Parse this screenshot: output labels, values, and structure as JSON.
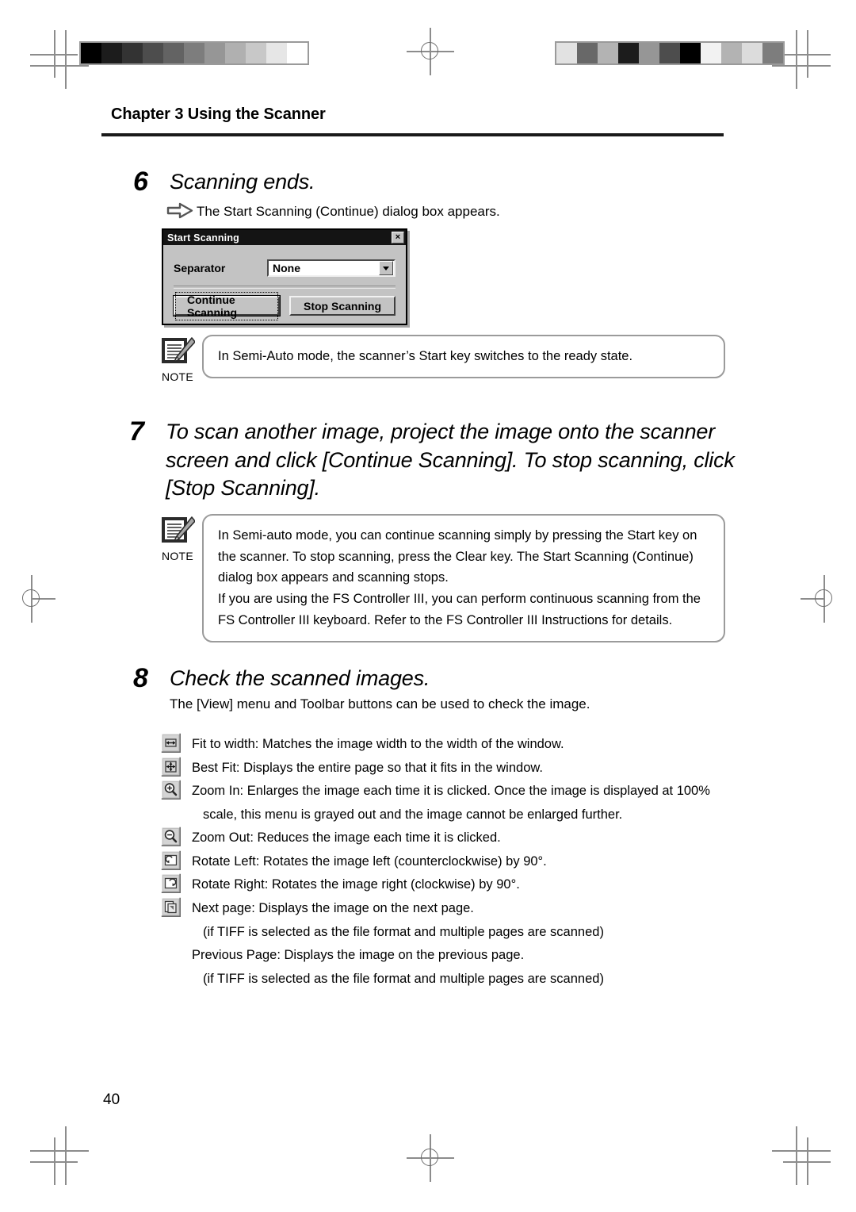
{
  "page": {
    "chapter_header": "Chapter 3 Using the Scanner",
    "page_number": "40"
  },
  "steps": [
    {
      "number": "6",
      "title": "Scanning ends.",
      "callout_arrow_text": "The Start Scanning (Continue) dialog box appears."
    },
    {
      "number": "7",
      "title": "To scan another image, project the image onto the scanner screen and click [Continue Scanning]. To stop scanning, click [Stop Scanning]."
    },
    {
      "number": "8",
      "title": "Check the scanned images.",
      "intro": "The [View] menu and Toolbar buttons can be used to check the image."
    }
  ],
  "dialog": {
    "title": "Start Scanning",
    "close_label": "×",
    "separator_label": "Separator",
    "separator_value": "None",
    "separator_options": [
      "None"
    ],
    "continue_button": "Continue Scanning",
    "stop_button": "Stop Scanning"
  },
  "notes": [
    {
      "label": "NOTE",
      "lines": [
        "In Semi-Auto mode, the scanner’s Start key switches to the ready state."
      ]
    },
    {
      "label": "NOTE",
      "lines": [
        "In Semi-auto mode, you can continue scanning simply by pressing the Start key on the scanner. To stop scanning, press the Clear key. The Start Scanning (Continue) dialog box appears and scanning stops.",
        "If you are using the FS Controller III, you can perform continuous scanning from the FS Controller III keyboard. Refer to the FS Controller III Instructions for details."
      ]
    }
  ],
  "toolbar_items": [
    {
      "icon": "fit-to-width-icon",
      "text": "Fit to width: Matches the image width to the width of the window."
    },
    {
      "icon": "best-fit-icon",
      "text": "Best Fit: Displays the entire page so that it fits in the window."
    },
    {
      "icon": "zoom-in-icon",
      "text": "Zoom In: Enlarges the image each time it is clicked. Once the image is displayed at 100%"
    },
    {
      "icon": "none",
      "text": "scale, this menu is grayed out and the image cannot be enlarged further.",
      "indent": true
    },
    {
      "icon": "zoom-out-icon",
      "text": "Zoom Out: Reduces the image each time it is clicked."
    },
    {
      "icon": "rotate-left-icon",
      "text": "Rotate Left: Rotates the image left (counterclockwise) by 90°."
    },
    {
      "icon": "rotate-right-icon",
      "text": "Rotate Right: Rotates the image right (clockwise) by 90°."
    },
    {
      "icon": "next-page-icon",
      "text": "Next page: Displays the image on the next page."
    },
    {
      "icon": "none",
      "text": "(if TIFF is selected as the file format and multiple pages are scanned)",
      "indent": true
    },
    {
      "icon": "none",
      "text": "Previous Page: Displays the image on the previous page.",
      "indent": false
    },
    {
      "icon": "none",
      "text": "(if TIFF is selected as the file format and multiple pages are scanned)",
      "indent": true
    }
  ],
  "calibration": {
    "left_strip_grays": [
      "#000000",
      "#1c1c1c",
      "#333333",
      "#4d4d4d",
      "#636363",
      "#7d7d7d",
      "#969696",
      "#b0b0b0",
      "#c8c8c8",
      "#e6e6e6",
      "#ffffff"
    ],
    "right_strip_grays": [
      "#e2e2e2",
      "#686868",
      "#b3b3b3",
      "#1c1c1c",
      "#969696",
      "#4d4d4d",
      "#000000",
      "#f2f2f2",
      "#b3b3b3",
      "#dcdcdc",
      "#7d7d7d"
    ]
  }
}
